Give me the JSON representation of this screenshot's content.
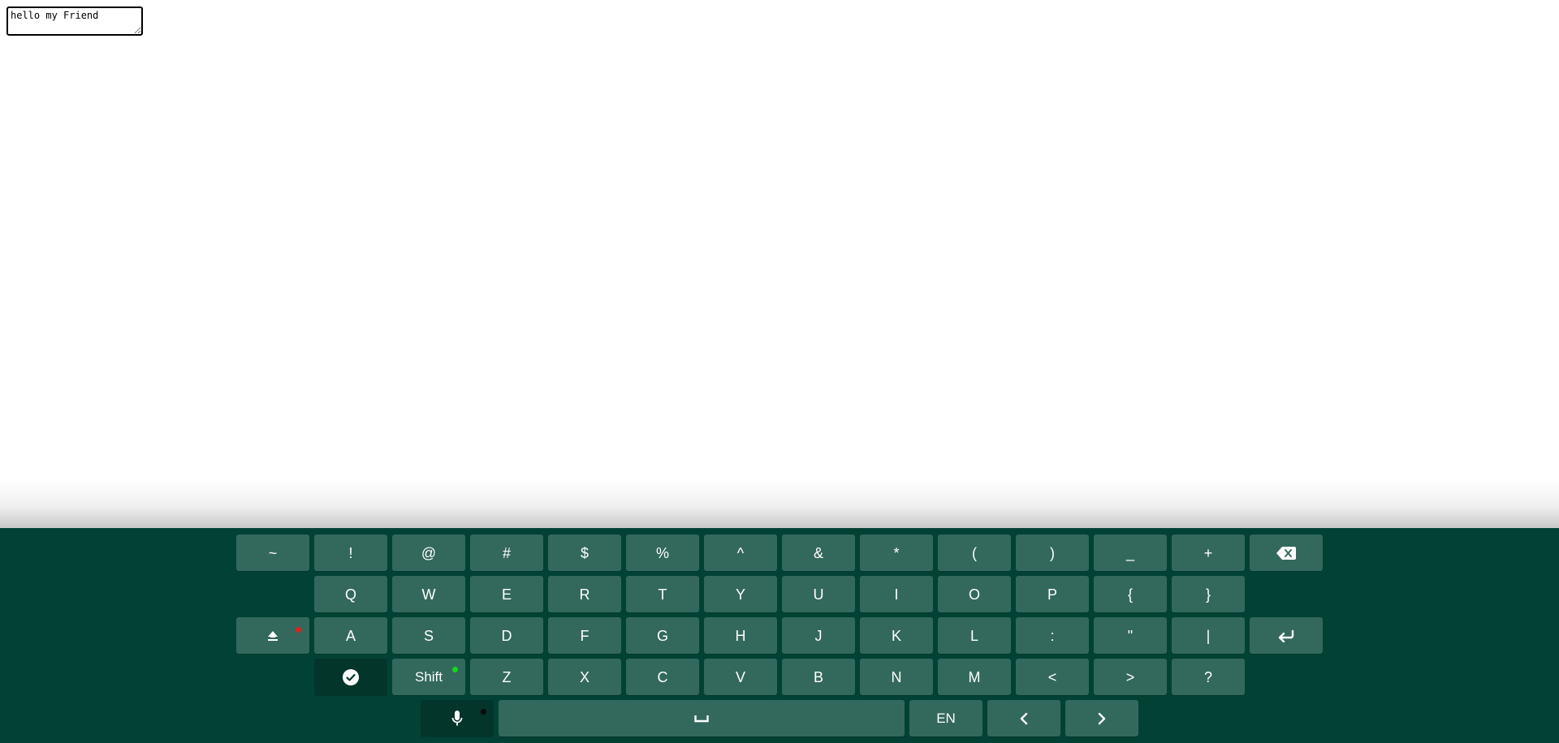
{
  "editor": {
    "value": "hello my Friend"
  },
  "keyboard": {
    "row1": [
      "~",
      "!",
      "@",
      "#",
      "$",
      "%",
      "^",
      "&",
      "*",
      "(",
      ")",
      "_",
      "+"
    ],
    "row2": [
      "Q",
      "W",
      "E",
      "R",
      "T",
      "Y",
      "U",
      "I",
      "O",
      "P",
      "{",
      "}"
    ],
    "row3": [
      "A",
      "S",
      "D",
      "F",
      "G",
      "H",
      "J",
      "K",
      "L",
      ":",
      "\"",
      "|"
    ],
    "row4": [
      "Z",
      "X",
      "C",
      "V",
      "B",
      "N",
      "M",
      "<",
      ">",
      "?"
    ],
    "shift_label": "Shift",
    "language_label": "EN",
    "icons": {
      "backspace": "backspace-icon",
      "caps_lock": "caps-lock-icon",
      "enter": "enter-icon",
      "done": "check-circle-icon",
      "mic": "microphone-icon",
      "space": "space-bar-icon",
      "left": "chevron-left-icon",
      "right": "chevron-right-icon"
    },
    "colors": {
      "background": "#024235",
      "key": "#33695c",
      "key_dark": "#03352b",
      "caps_indicator": "#e0201c",
      "shift_indicator": "#14d81a",
      "mic_indicator": "#0b0b0b"
    }
  }
}
